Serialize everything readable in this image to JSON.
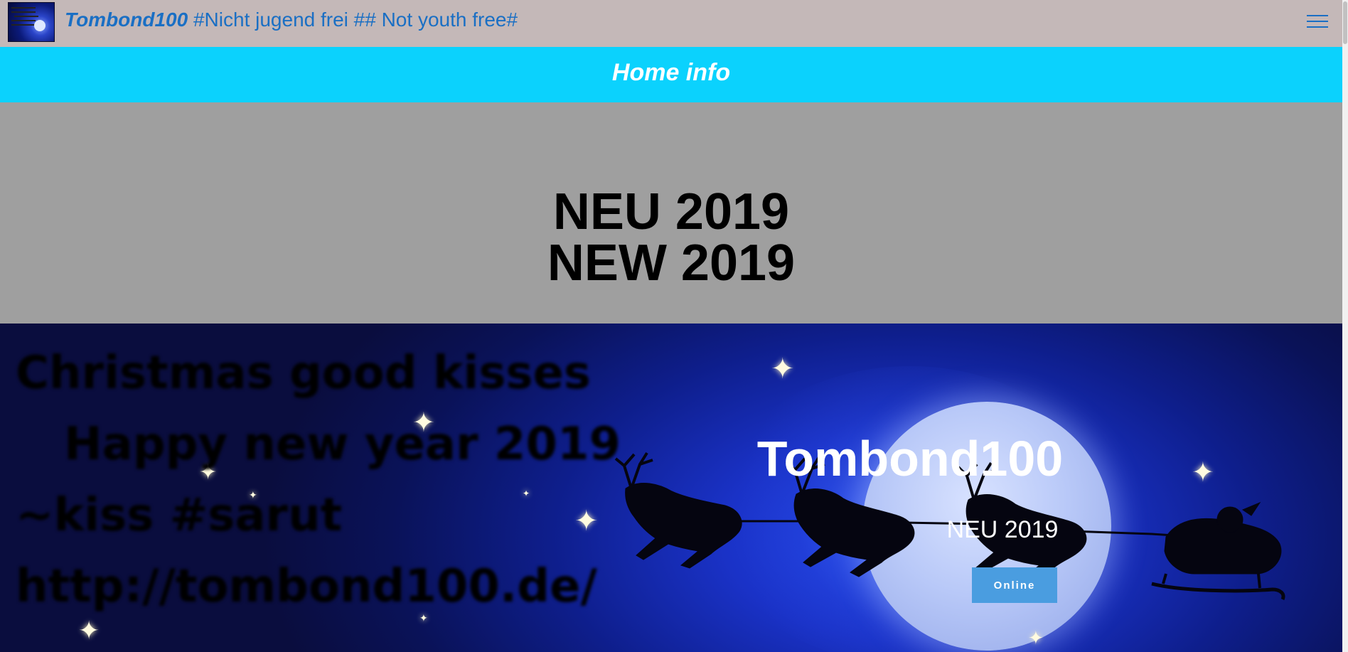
{
  "navbar": {
    "brand_name": "Tombond100",
    "brand_tagline": " #Nicht jugend frei ## Not youth free#",
    "logo_icon": "site-logo",
    "menu_icon": "hamburger-menu-icon",
    "brand_color": "#1a6fc4",
    "background": "#c4b8b8"
  },
  "info_bar": {
    "title": "Home info",
    "background": "#0bd2fd"
  },
  "banner": {
    "line1": "NEU 2019",
    "line2": "NEW 2019",
    "background": "#9f9f9f"
  },
  "hero": {
    "image_text": {
      "line1": "Christmas good kisses",
      "line2": "Happy new year 2019",
      "line3": "~kiss #sarut",
      "line4": "http://tombond100.de/"
    },
    "title": "Tombond100",
    "subtitle": "NEU 2019",
    "button_label": "Online",
    "button_color": "#4a9de0"
  }
}
